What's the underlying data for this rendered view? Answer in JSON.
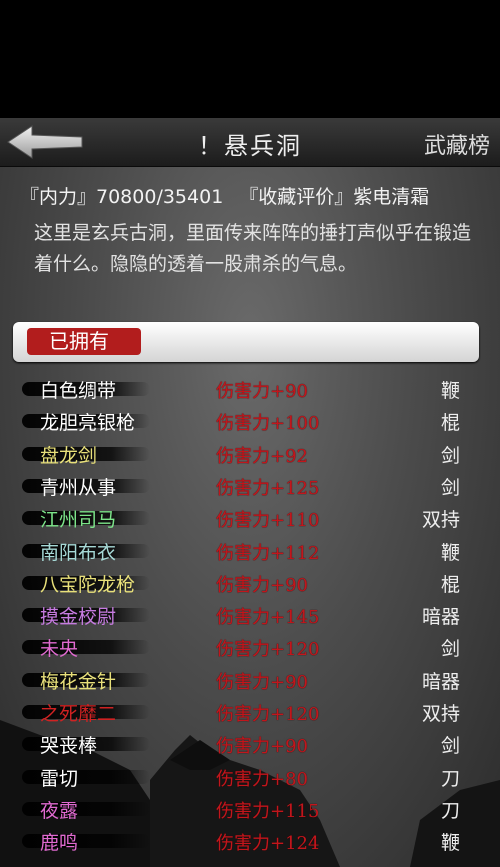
{
  "header": {
    "title": "！悬兵洞",
    "ranking_label": "武藏榜"
  },
  "stats": {
    "inner_power": "『内力』70800/35401",
    "collection": "『收藏评价』紫电清霜"
  },
  "description": "这里是玄兵古洞，里面传来阵阵的捶打声似乎在锻造着什么。隐隐的透着一股肃杀的气息。",
  "owned_tab": "已拥有",
  "weapons": [
    {
      "name": "白色绸带",
      "damage": "伤害力+90",
      "type": "鞭",
      "color": "#ffffff"
    },
    {
      "name": "龙胆亮银枪",
      "damage": "伤害力+100",
      "type": "棍",
      "color": "#ffffff"
    },
    {
      "name": "盘龙剑",
      "damage": "伤害力+92",
      "type": "剑",
      "color": "#e8e07a"
    },
    {
      "name": "青州从事",
      "damage": "伤害力+125",
      "type": "剑",
      "color": "#ffffff"
    },
    {
      "name": "江州司马",
      "damage": "伤害力+110",
      "type": "双持",
      "color": "#7de58a"
    },
    {
      "name": "南阳布衣",
      "damage": "伤害力+112",
      "type": "鞭",
      "color": "#a6d9d6"
    },
    {
      "name": "八宝陀龙枪",
      "damage": "伤害力+90",
      "type": "棍",
      "color": "#e8e07a"
    },
    {
      "name": "摸金校尉",
      "damage": "伤害力+145",
      "type": "暗器",
      "color": "#c67be0"
    },
    {
      "name": "未央",
      "damage": "伤害力+120",
      "type": "剑",
      "color": "#e06ad0"
    },
    {
      "name": "梅花金针",
      "damage": "伤害力+90",
      "type": "暗器",
      "color": "#e8e07a"
    },
    {
      "name": "之死靡二",
      "damage": "伤害力+120",
      "type": "双持",
      "color": "#d02222"
    },
    {
      "name": "哭丧棒",
      "damage": "伤害力+90",
      "type": "剑",
      "color": "#ffffff"
    },
    {
      "name": "雷切",
      "damage": "伤害力+80",
      "type": "刀",
      "color": "#ffffff"
    },
    {
      "name": "夜露",
      "damage": "伤害力+115",
      "type": "刀",
      "color": "#e06ad0"
    },
    {
      "name": "鹿鸣",
      "damage": "伤害力+124",
      "type": "鞭",
      "color": "#e06ad0"
    }
  ],
  "icons": {
    "back": "back-arrow-icon"
  }
}
